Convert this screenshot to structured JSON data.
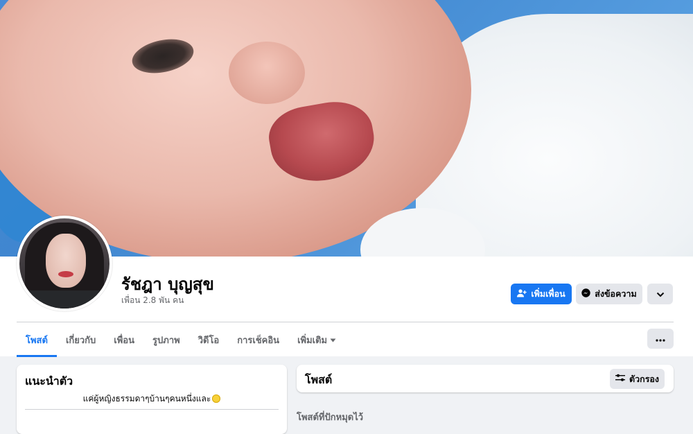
{
  "profile": {
    "name": "รัชฎา บุญสุข",
    "friends": "เพื่อน 2.8 พัน คน",
    "bio": "แค่ผู้หญิงธรรมดาๆบ้านๆคนหนึ่งและ"
  },
  "actions": {
    "add_friend": "เพิ่มเพื่อน",
    "message": "ส่งข้อความ"
  },
  "tabs": [
    {
      "label": "โพสต์"
    },
    {
      "label": "เกี่ยวกับ"
    },
    {
      "label": "เพื่อน"
    },
    {
      "label": "รูปภาพ"
    },
    {
      "label": "วิดีโอ"
    },
    {
      "label": "การเช็คอิน"
    },
    {
      "label": "เพิ่มเติม"
    }
  ],
  "intro": {
    "title": "แนะนำตัว"
  },
  "posts": {
    "title": "โพสต์",
    "filter": "ตัวกรอง",
    "pinned": "โพสต์ที่ปักหมุดไว้"
  },
  "colors": {
    "accent": "#1877f2",
    "background": "#f0f2f5"
  },
  "icons": {
    "add_friend": "person-plus-icon",
    "message": "messenger-icon",
    "expand": "chevron-down-icon",
    "more": "ellipsis-icon",
    "more_tab": "caret-down-icon",
    "filter": "sliders-icon",
    "emoji": "smiling-face-icon"
  }
}
